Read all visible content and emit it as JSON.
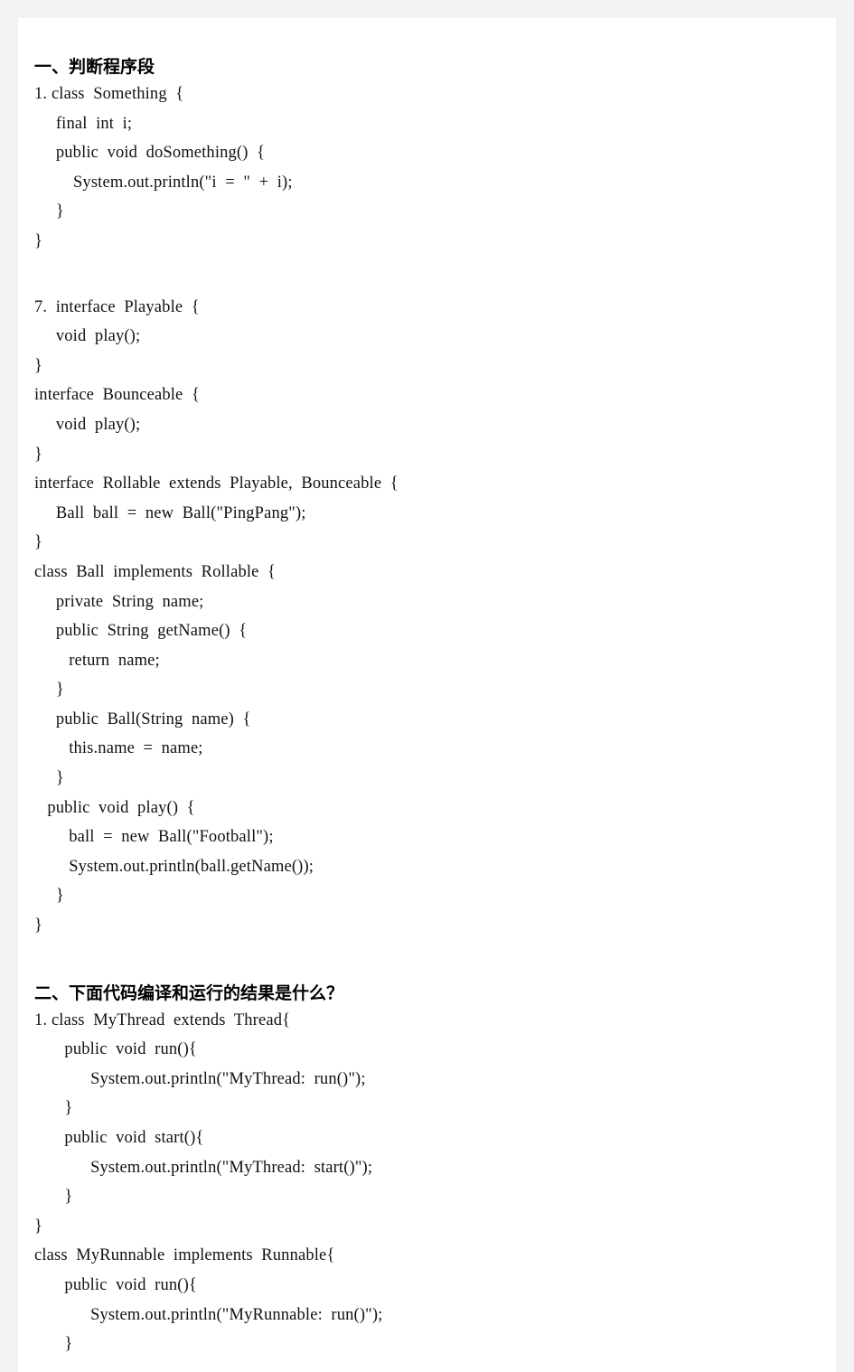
{
  "document": {
    "page_background": "#ffffff",
    "outer_background": "#f3f3f4",
    "text_color": "#111111"
  },
  "sections": [
    {
      "heading": "一、判断程序段",
      "blocks": [
        {
          "id": "question-1",
          "lines": [
            "1. class  Something  {",
            "     final  int  i;",
            "     public  void  doSomething()  {",
            "         System.out.println(\"i  =  \"  +  i);",
            "     }",
            "}"
          ]
        },
        {
          "id": "question-7",
          "lines": [
            "7.  interface  Playable  {",
            "     void  play();",
            "}",
            "interface  Bounceable  {",
            "     void  play();",
            "}",
            "interface  Rollable  extends  Playable,  Bounceable  {",
            "     Ball  ball  =  new  Ball(\"PingPang\");",
            "}",
            "class  Ball  implements  Rollable  {",
            "     private  String  name;",
            "     public  String  getName()  {",
            "        return  name;",
            "     }",
            "     public  Ball(String  name)  {",
            "        this.name  =  name;",
            "     }",
            "   public  void  play()  {",
            "        ball  =  new  Ball(\"Football\");",
            "        System.out.println(ball.getName());",
            "     }",
            "}"
          ]
        }
      ]
    },
    {
      "heading": "二、下面代码编译和运行的结果是什么？",
      "blocks": [
        {
          "id": "question-2-1",
          "lines": [
            "1. class  MyThread  extends  Thread{",
            "       public  void  run(){",
            "             System.out.println(\"MyThread:  run()\");",
            "       }",
            "       public  void  start(){",
            "             System.out.println(\"MyThread:  start()\");",
            "       }",
            "}",
            "class  MyRunnable  implements  Runnable{",
            "       public  void  run(){",
            "             System.out.println(\"MyRunnable:  run()\");",
            "       }"
          ]
        }
      ]
    }
  ]
}
